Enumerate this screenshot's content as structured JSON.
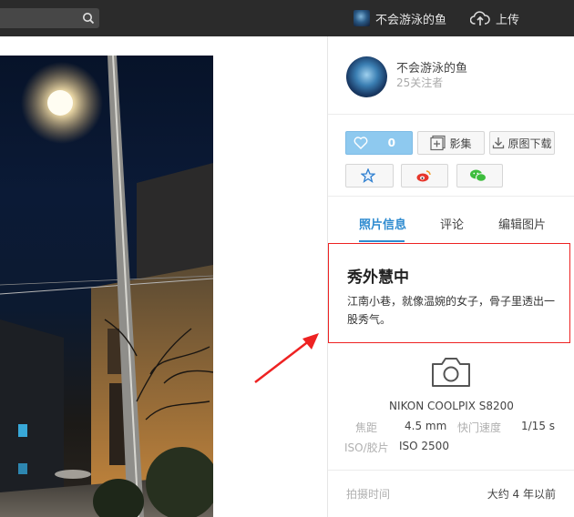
{
  "topbar": {
    "search_placeholder": "",
    "username": "不会游泳的鱼",
    "upload_label": "上传"
  },
  "profile": {
    "name": "不会游泳的鱼",
    "followers": "25关注者"
  },
  "actions": {
    "like_count": "0",
    "album_label": "影集",
    "download_label": "原图下载"
  },
  "tabs": [
    {
      "label": "照片信息"
    },
    {
      "label": "评论"
    },
    {
      "label": "编辑图片"
    }
  ],
  "photo_info": {
    "title": "秀外慧中",
    "description": "江南小巷，就像温婉的女子，骨子里透出一股秀气。"
  },
  "camera": {
    "model": "NIKON COOLPIX S8200",
    "focal_label": "焦距",
    "focal_value": "4.5 mm",
    "shutter_label": "快门速度",
    "shutter_value": "1/15 s",
    "iso_label": "ISO/胶片",
    "iso_value": "ISO 2500"
  },
  "meta": {
    "shot_time_label": "拍摄时间",
    "shot_time_value": "大约 4 年以前"
  },
  "colors": {
    "accent": "#2e8bd0",
    "like_button": "#8ec9ef",
    "highlight_box": "#ee2222",
    "topbar": "#2b2b2b"
  }
}
